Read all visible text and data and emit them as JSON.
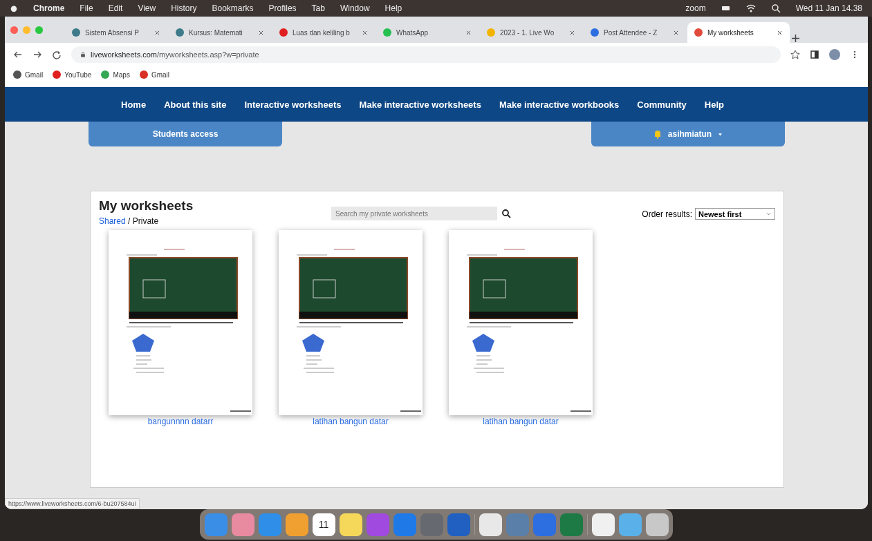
{
  "menu_bar": {
    "app": "Chrome",
    "items": [
      "File",
      "Edit",
      "View",
      "History",
      "Bookmarks",
      "Profiles",
      "Tab",
      "Window",
      "Help"
    ],
    "status_text": "zoom",
    "clock": "Wed 11 Jan  14.38"
  },
  "tabs": [
    {
      "title": "Sistem Absensi P",
      "selected": false,
      "color": "#3d7a8a"
    },
    {
      "title": "Kursus: Matemati",
      "selected": false,
      "color": "#3d7a8a"
    },
    {
      "title": "Luas dan keliling b",
      "selected": false,
      "color": "#e02020"
    },
    {
      "title": "WhatsApp",
      "selected": false,
      "color": "#25c050"
    },
    {
      "title": "2023 - 1. Live Wo",
      "selected": false,
      "color": "#f2b400"
    },
    {
      "title": "Post Attendee - Z",
      "selected": false,
      "color": "#2d6ee0"
    },
    {
      "title": "My worksheets",
      "selected": true,
      "color": "#e04a3a"
    }
  ],
  "address_bar": {
    "host": "liveworksheets.com",
    "path": "/myworksheets.asp?w=private"
  },
  "bookmarks": [
    {
      "label": "Gmail",
      "color": "#555555"
    },
    {
      "label": "YouTube",
      "color": "#e02020"
    },
    {
      "label": "Maps",
      "color": "#34a853"
    },
    {
      "label": "Gmail",
      "color": "#d93025"
    }
  ],
  "site_nav": [
    "Home",
    "About this site",
    "Interactive worksheets",
    "Make interactive worksheets",
    "Make interactive workbooks",
    "Community",
    "Help"
  ],
  "students_access": "Students access",
  "user_menu": "asihmiatun",
  "panel": {
    "title": "My worksheets",
    "shared_link": "Shared",
    "separator": " / ",
    "current": "Private",
    "search": {
      "placeholder": "Search my private worksheets"
    },
    "order_label": "Order results:",
    "order_value": "Newest first"
  },
  "worksheets": [
    {
      "title": "bangunnnn datarr"
    },
    {
      "title": "latihan bangun datar"
    },
    {
      "title": "latihan bangun datar"
    }
  ],
  "status_url": "https://www.liveworksheets.com/6-bu207584ui",
  "dock": [
    {
      "color": "#3a8ee6"
    },
    {
      "color": "#e88aa0"
    },
    {
      "color": "#2f8fe8"
    },
    {
      "color": "#f0a030"
    },
    {
      "color": "#ffffff",
      "label": "11"
    },
    {
      "color": "#f5d75a"
    },
    {
      "color": "#a04adf"
    },
    {
      "color": "#1f7ae8"
    },
    {
      "color": "#666a70"
    },
    {
      "color": "#2160c0"
    },
    {
      "color": "#e8e8e8"
    },
    {
      "color": "#5a7fa8"
    },
    {
      "color": "#2d6ee0"
    },
    {
      "color": "#1e7a44"
    },
    {
      "color": "#f0f0f0"
    },
    {
      "color": "#5ab0e8"
    },
    {
      "color": "#c8c8c8"
    }
  ]
}
